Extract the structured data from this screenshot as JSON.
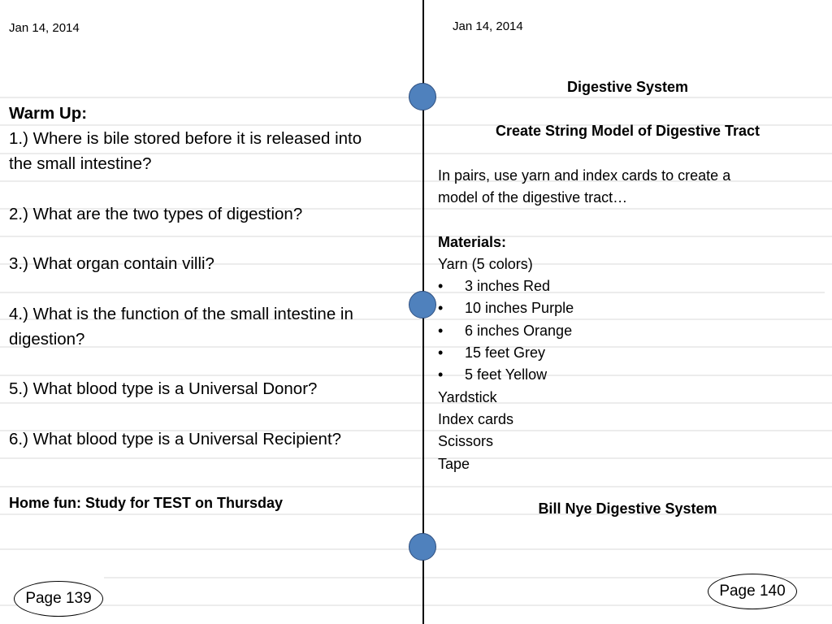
{
  "left_page": {
    "date": "Jan 14, 2014",
    "warm_up_title": "Warm Up:",
    "questions": [
      "1.) Where is bile stored before it is released into",
      "the small intestine?",
      "2.) What are the two types of digestion?",
      "3.) What organ contain villi?",
      "4.) What is the function of the small intestine in",
      "digestion?",
      "5.) What blood type is a Universal Donor?",
      "6.) What blood type is a Universal Recipient?"
    ],
    "home_fun": "Home fun: Study for TEST on Thursday",
    "page_number": "Page 139"
  },
  "right_page": {
    "date": "Jan 14, 2014",
    "title": "Digestive System",
    "subtitle": "Create String Model of Digestive Tract",
    "instructions": [
      "In pairs, use yarn and index cards to create a",
      "model of the digestive tract…"
    ],
    "materials_title": "Materials:",
    "yarn_label": "Yarn (5 colors)",
    "yarn_items": [
      "3 inches Red",
      "10 inches Purple",
      "6 inches Orange",
      "15 feet Grey",
      "5 feet Yellow"
    ],
    "bullet": "•",
    "other_materials": [
      "Yardstick",
      "Index cards",
      "Scissors",
      "Tape"
    ],
    "video": "Bill Nye Digestive System",
    "page_number": "Page 140"
  },
  "colors": {
    "ring": "#4f81bd",
    "rule": "#ececec"
  }
}
